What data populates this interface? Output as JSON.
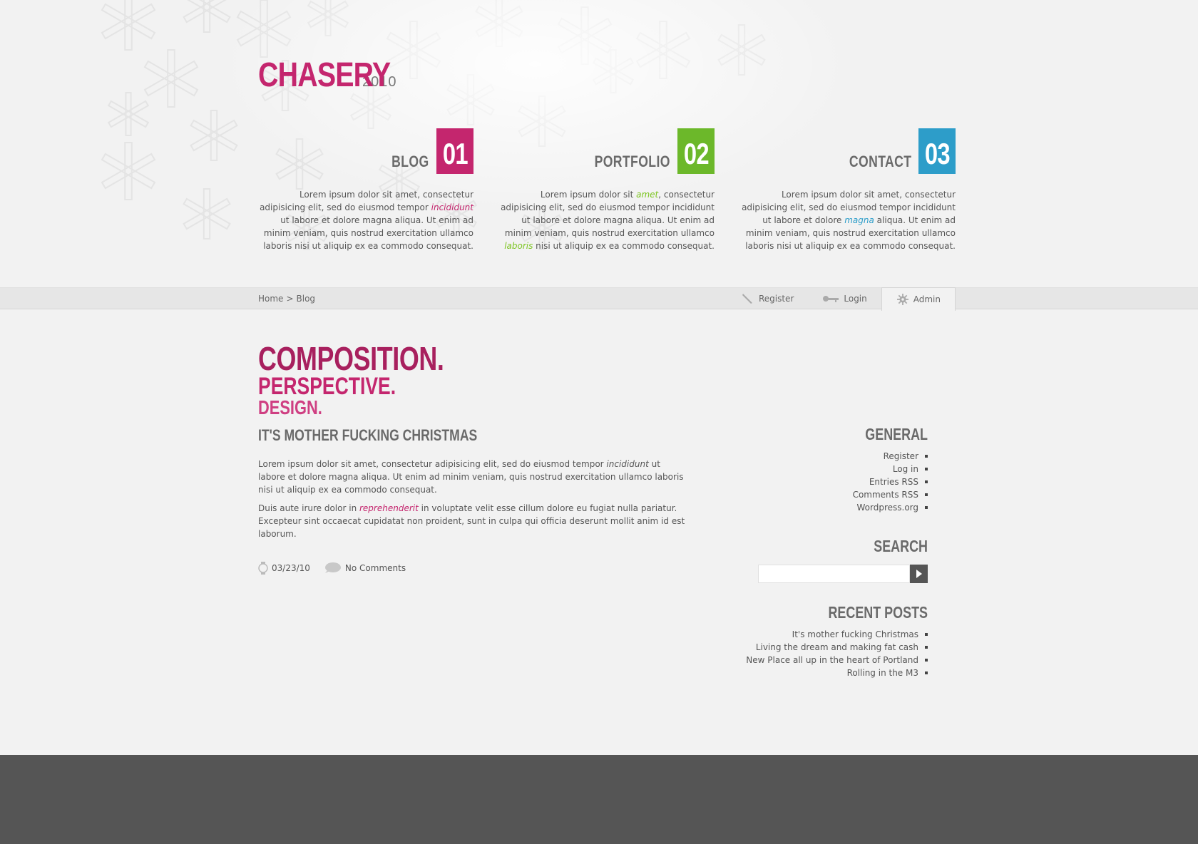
{
  "site": {
    "name": "CHASERY",
    "year": "2010"
  },
  "features": [
    {
      "title": "BLOG",
      "number": "01",
      "color": "#c4266e",
      "accent": "#c4266e",
      "text_parts": [
        "Lorem ipsum dolor sit amet, consectetur adipisicing elit, sed do eiusmod tempor ",
        "incididunt",
        " ut labore et dolore magna aliqua. Ut enim ad minim veniam, quis nostrud exercitation ullamco laboris nisi ut aliquip ex ea commodo consequat."
      ]
    },
    {
      "title": "PORTFOLIO",
      "number": "02",
      "color": "#6cb82a",
      "accent": "#7cc520",
      "text_parts": [
        "Lorem ipsum dolor sit ",
        "amet",
        ", consectetur adipisicing elit, sed do eiusmod tempor incididunt ut labore et dolore magna aliqua. Ut enim ad minim veniam, quis nostrud exercitation ullamco ",
        "laboris",
        " nisi ut aliquip ex ea commodo consequat."
      ]
    },
    {
      "title": "CONTACT",
      "number": "03",
      "color": "#2d9dc9",
      "accent": "#2d9dc9",
      "text_parts": [
        "Lorem ipsum dolor sit amet, consectetur adipisicing elit, sed do eiusmod tempor incididunt ut labore et dolore ",
        "magna",
        " aliqua. Ut enim ad minim veniam, quis nostrud exercitation ullamco laboris nisi ut aliquip ex ea commodo consequat."
      ]
    }
  ],
  "breadcrumb": {
    "home": "Home",
    "separator": ">",
    "current": "Blog"
  },
  "nav": {
    "register": "Register",
    "login": "Login",
    "admin": "Admin"
  },
  "tagline": {
    "line1": "COMPOSITION.",
    "line2": "PERSPECTIVE.",
    "line3": "DESIGN."
  },
  "post": {
    "title": "IT'S MOTHER FUCKING CHRISTMAS",
    "p1_a": "Lorem ipsum dolor sit amet, consectetur adipisicing elit, sed do eiusmod tempor ",
    "p1_em": "incididunt",
    "p1_b": " ut labore et dolore magna aliqua. Ut enim ad minim veniam, quis nostrud exercitation ullamco laboris nisi ut aliquip ex ea commodo consequat.",
    "p2_a": "Duis aute irure dolor in ",
    "p2_em": "reprehenderit",
    "p2_b": " in voluptate velit esse cillum dolore eu fugiat nulla pariatur. Excepteur sint occaecat cupidatat non proident, sunt in culpa qui officia deserunt mollit anim id est laborum.",
    "date": "03/23/10",
    "comments": "No Comments"
  },
  "sidebar": {
    "general_title": "GENERAL",
    "general_links": [
      "Register",
      "Log in",
      "Entries RSS",
      "Comments RSS",
      "Wordpress.org"
    ],
    "search_title": "SEARCH",
    "search_value": "",
    "recent_title": "RECENT POSTS",
    "recent_links": [
      "It's mother fucking Christmas",
      "Living the dream and making fat cash",
      "New Place all up in the heart of Portland",
      "Rolling in the M3"
    ]
  },
  "colors": {
    "brand": "#c4266e",
    "footer": "#555555",
    "background": "#f2f2f2"
  }
}
